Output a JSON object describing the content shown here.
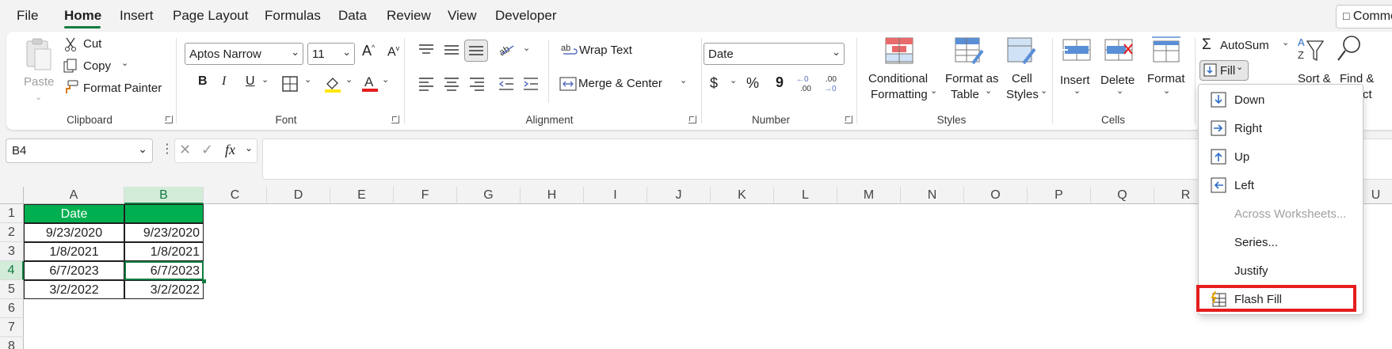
{
  "menu": {
    "tabs": [
      "File",
      "Home",
      "Insert",
      "Page Layout",
      "Formulas",
      "Data",
      "Review",
      "View",
      "Developer"
    ],
    "active": "Home",
    "comments_label": "Comments"
  },
  "clipboard": {
    "paste": "Paste",
    "cut": "Cut",
    "copy": "Copy",
    "format_painter": "Format Painter",
    "group": "Clipboard"
  },
  "font": {
    "family": "Aptos Narrow",
    "size": "11",
    "group": "Font",
    "bold": "B",
    "italic": "I",
    "underline": "U"
  },
  "alignment": {
    "wrap_text": "Wrap Text",
    "merge_center": "Merge & Center",
    "group": "Alignment"
  },
  "number": {
    "format": "Date",
    "group": "Number",
    "currency": "$",
    "percent": "%",
    "comma": "9",
    "inc_dec": ".00",
    "dec_dec": ".00"
  },
  "styles": {
    "conditional": [
      "Conditional",
      "Formatting"
    ],
    "format_table": [
      "Format as",
      "Table"
    ],
    "cell_styles": [
      "Cell",
      "Styles"
    ],
    "group": "Styles"
  },
  "cells": {
    "insert": "Insert",
    "delete": "Delete",
    "format": "Format",
    "group": "Cells"
  },
  "editing": {
    "autosum": "AutoSum",
    "fill": "Fill",
    "sort": "Sort &",
    "find": "Find &",
    "find_tail": "ct"
  },
  "formula_bar": {
    "name_box": "B4",
    "fx": "fx",
    "formula": ""
  },
  "grid": {
    "columns": [
      "A",
      "B",
      "C",
      "D",
      "E",
      "F",
      "G",
      "H",
      "I",
      "J",
      "K",
      "L",
      "M",
      "N",
      "O",
      "P",
      "Q",
      "R",
      "U"
    ],
    "rows": [
      "1",
      "2",
      "3",
      "4",
      "5",
      "6",
      "7",
      "8"
    ],
    "selected_cell": "B4",
    "header_a": "Date",
    "header_b": "",
    "data": [
      [
        "9/23/2020",
        "9/23/2020"
      ],
      [
        "1/8/2021",
        "1/8/2021"
      ],
      [
        "6/7/2023",
        "6/7/2023"
      ],
      [
        "3/2/2022",
        "3/2/2022"
      ]
    ]
  },
  "fill_menu": {
    "items": [
      {
        "label": "Down",
        "icon": "fill-down-icon",
        "enabled": true
      },
      {
        "label": "Right",
        "icon": "fill-right-icon",
        "enabled": true
      },
      {
        "label": "Up",
        "icon": "fill-up-icon",
        "enabled": true
      },
      {
        "label": "Left",
        "icon": "fill-left-icon",
        "enabled": true
      },
      {
        "label": "Across Worksheets...",
        "icon": "",
        "enabled": false
      },
      {
        "label": "Series...",
        "icon": "",
        "enabled": true
      },
      {
        "label": "Justify",
        "icon": "",
        "enabled": true
      },
      {
        "label": "Flash Fill",
        "icon": "flash-fill-icon",
        "enabled": true,
        "highlighted": true
      }
    ]
  },
  "colors": {
    "accent": "#107c41",
    "header_fill": "#00b050",
    "highlight": "#e51d1d",
    "font_color": "#e51d1d",
    "fill_color": "#ffe600"
  }
}
